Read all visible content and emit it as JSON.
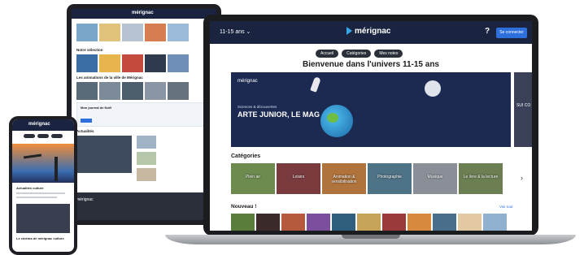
{
  "laptop": {
    "age_selector": "11-15 ans ⌄",
    "logo_text": "mérignac",
    "help_label": "?",
    "login_label": "Se connecter",
    "nav_pills": [
      "Accueil",
      "Catégories",
      "Mes notes"
    ],
    "page_title": "Bienvenue dans l'univers 11-15 ans",
    "hero": {
      "logo_text": "mérignac",
      "kicker": "Sciences & découvertes",
      "title": "ARTE JUNIOR, LE MAG",
      "side_text": "SUI CO"
    },
    "categories_heading": "Catégories",
    "categories": [
      "Plein air",
      "Loisirs",
      "Animation & sensibilisation",
      "Photographie",
      "Musique",
      "Le livre & la lecture"
    ],
    "categories_arrow": "›",
    "new_heading": "Nouveau !",
    "new_more": "Voir tout"
  },
  "tablet": {
    "logo_text": "mérignac",
    "section_1": "Notre sélection",
    "section_2": "Les animations de la ville de Mérignac",
    "news_title": "Mon journal de Noël",
    "section_3": "Actualités",
    "footer_logo": "mérignac"
  },
  "phone": {
    "logo_text": "mérignac",
    "caption": "Actualités culture",
    "bottom_caption": "Le cinéma de mérignac culture"
  },
  "colors": {
    "header_navy": "#1a2440",
    "accent_blue": "#2d6fdc",
    "logo_blue": "#35a7e8",
    "device_dark": "#1b1c20"
  },
  "icons": [
    "play-logo-icon",
    "help-icon",
    "chevron-right-icon",
    "rocket-icon",
    "astronaut-icon",
    "planet-icon"
  ]
}
